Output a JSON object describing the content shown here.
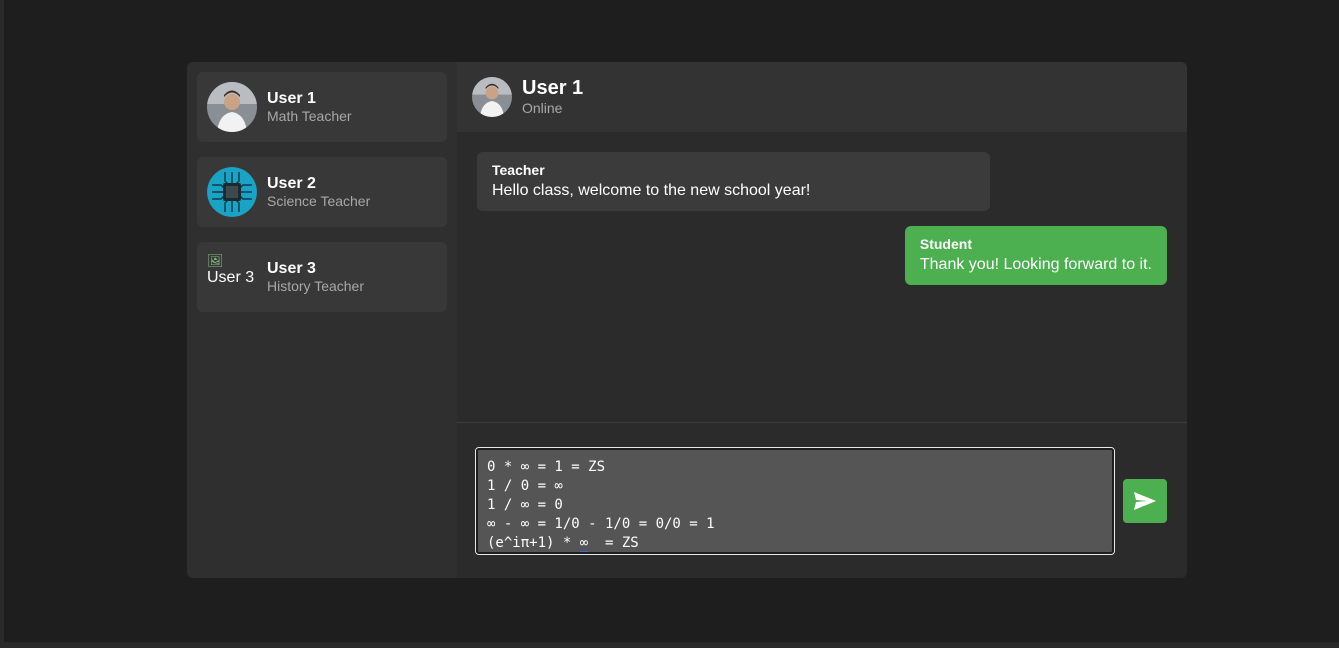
{
  "contacts": [
    {
      "name": "User 1",
      "role": "Math Teacher",
      "avatar": "photo-avatar"
    },
    {
      "name": "User 2",
      "role": "Science Teacher",
      "avatar": "chip-avatar"
    },
    {
      "name": "User 3",
      "role": "History Teacher",
      "avatar_alt": "User 3"
    }
  ],
  "chat_header": {
    "name": "User 1",
    "status": "Online"
  },
  "messages": [
    {
      "sender": "Teacher",
      "text": "Hello class, welcome to the new school year!"
    },
    {
      "sender": "Student",
      "text": "Thank you! Looking forward to it."
    }
  ],
  "composer": {
    "lines": [
      "0 * ∞ = 1 = ZS",
      "1 / 0 = ∞",
      "1 / ∞ = 0",
      "∞ - ∞ = 1/0 - 1/0 = 0/0 = 1"
    ],
    "line5_prefix": "(e^iπ+1) * ",
    "line5_underlined": "∞",
    "line5_suffix": "  = ZS"
  },
  "colors": {
    "accent": "#4caf50",
    "background": "#1e1e1e",
    "panel": "#2b2b2b"
  },
  "icons": {
    "send": "send-icon"
  }
}
